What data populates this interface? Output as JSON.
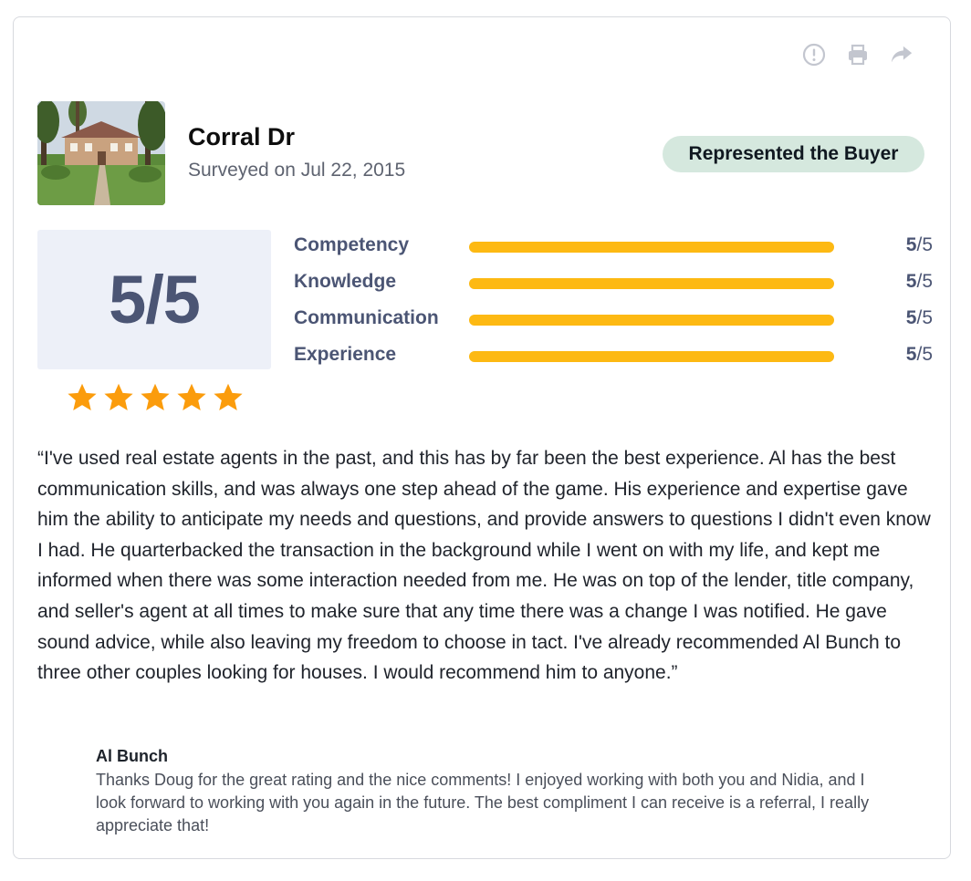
{
  "actions": [
    {
      "icon": "report-icon"
    },
    {
      "icon": "print-icon"
    },
    {
      "icon": "share-icon"
    }
  ],
  "property": {
    "address": "Corral Dr",
    "surveyed": "Surveyed on Jul 22, 2015",
    "badge": "Represented the Buyer",
    "photo_icon": "house-photo"
  },
  "rating": {
    "overall": "5/5",
    "stars": 5,
    "star_color": "#fb9c0c",
    "categories": [
      {
        "label": "Competency",
        "score": "5",
        "max": "/5",
        "fraction": 1.0
      },
      {
        "label": "Knowledge",
        "score": "5",
        "max": "/5",
        "fraction": 1.0
      },
      {
        "label": "Communication",
        "score": "5",
        "max": "/5",
        "fraction": 1.0
      },
      {
        "label": "Experience",
        "score": "5",
        "max": "/5",
        "fraction": 1.0
      }
    ],
    "bar_color": "#fdb913"
  },
  "review": {
    "text": "“I've used real estate agents in the past, and this has by far been the best experience. Al has the best communication skills, and was always one step ahead of the game. His experience and expertise gave him the ability to anticipate my needs and questions, and provide answers to questions I didn't even know I had. He quarterbacked the transaction in the background while I went on with my life, and kept me informed when there was some interaction needed from me. He was on top of the lender, title company, and seller's agent at all times to make sure that any time there was a change I was notified. He gave sound advice, while also leaving my freedom to choose in tact. I've already recommended Al Bunch to three other couples looking for houses. I would recommend him to anyone.”"
  },
  "reply": {
    "name": "Al Bunch",
    "text": "Thanks Doug for the great rating and the nice comments! I enjoyed working with both you and Nidia, and I look forward to working with you again in the future. The best compliment I can receive is a referral, I really appreciate that!"
  }
}
